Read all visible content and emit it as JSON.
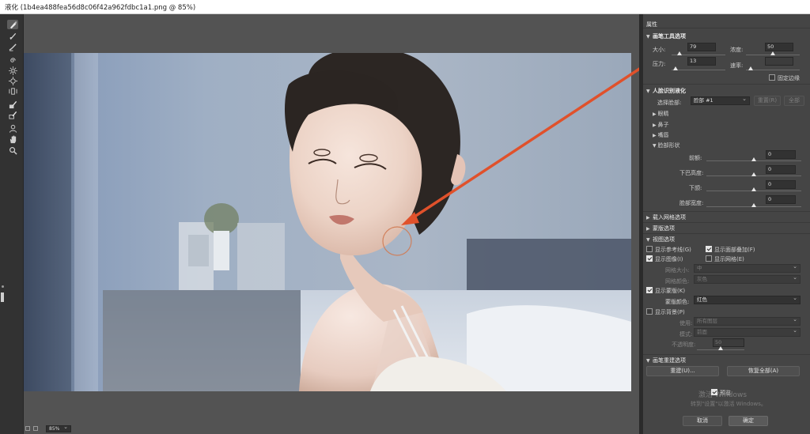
{
  "window": {
    "title": "液化 (1b4ea488fea56d8c06f42a962fdbc1a1.png @ 85%)"
  },
  "toolbar": {
    "tools": [
      "forward-warp-tool",
      "reconstruct-tool",
      "smooth-tool",
      "twirl-tool",
      "pucker-tool",
      "bloat-tool",
      "push-left-tool",
      "freeze-mask-tool",
      "thaw-mask-tool",
      "face-tool",
      "hand-tool",
      "zoom-tool"
    ]
  },
  "status": {
    "zoom": "85%"
  },
  "panel": {
    "title": "属性",
    "brush": {
      "section": "画笔工具选项",
      "size_label": "大小:",
      "size_value": "79",
      "density_label": "浓度:",
      "density_value": "50",
      "pressure_label": "压力:",
      "pressure_value": "13",
      "rate_label": "速率:",
      "rate_value": "",
      "pin_edges_label": "固定边缘"
    },
    "face": {
      "section": "人脸识别液化",
      "select_face_label": "选择脸部:",
      "select_face_value": "脸部 #1",
      "reset_button": "重置(R)",
      "all_button": "全部",
      "eyes": "眼睛",
      "nose": "鼻子",
      "mouth": "嘴唇",
      "face_shape": "脸部形状",
      "forehead_label": "前额:",
      "forehead_value": "0",
      "chin_height_label": "下巴高度:",
      "chin_height_value": "0",
      "jawline_label": "下颌:",
      "jawline_value": "0",
      "face_width_label": "脸部宽度:",
      "face_width_value": "0"
    },
    "load_mesh": {
      "section": "载入网格选项"
    },
    "mask": {
      "section": "蒙版选项"
    },
    "view": {
      "section": "视图选项",
      "show_guides": "显示参考线(G)",
      "show_face_overlay": "显示面部叠加(F)",
      "show_image": "显示图像(I)",
      "show_mesh": "显示网格(E)",
      "mesh_size_label": "网格大小:",
      "mesh_size_value": "中",
      "mesh_color_label": "网格颜色:",
      "mesh_color_value": "灰色",
      "show_mask": "显示蒙版(K)",
      "mask_color_label": "蒙版颜色:",
      "mask_color_value": "红色",
      "show_backdrop": "显示背景(P)",
      "use_label": "使用:",
      "use_value": "所有图层",
      "mode_label": "模式:",
      "mode_value": "前面",
      "opacity_label": "不透明度:",
      "opacity_value": "50"
    },
    "reconstruct": {
      "section": "画笔重建选项",
      "rebuild_button": "重建(U)...",
      "restore_all_button": "恢复全部(A)"
    },
    "preview_label": "预览",
    "cancel_button": "取消",
    "ok_button": "确定",
    "watermark_line1": "激活 Windows",
    "watermark_line2": "转到\"设置\"以激活 Windows。"
  },
  "colors": {
    "annotation": "#e0512b",
    "panel_bg": "#454545",
    "canvas_bg": "#535353"
  }
}
